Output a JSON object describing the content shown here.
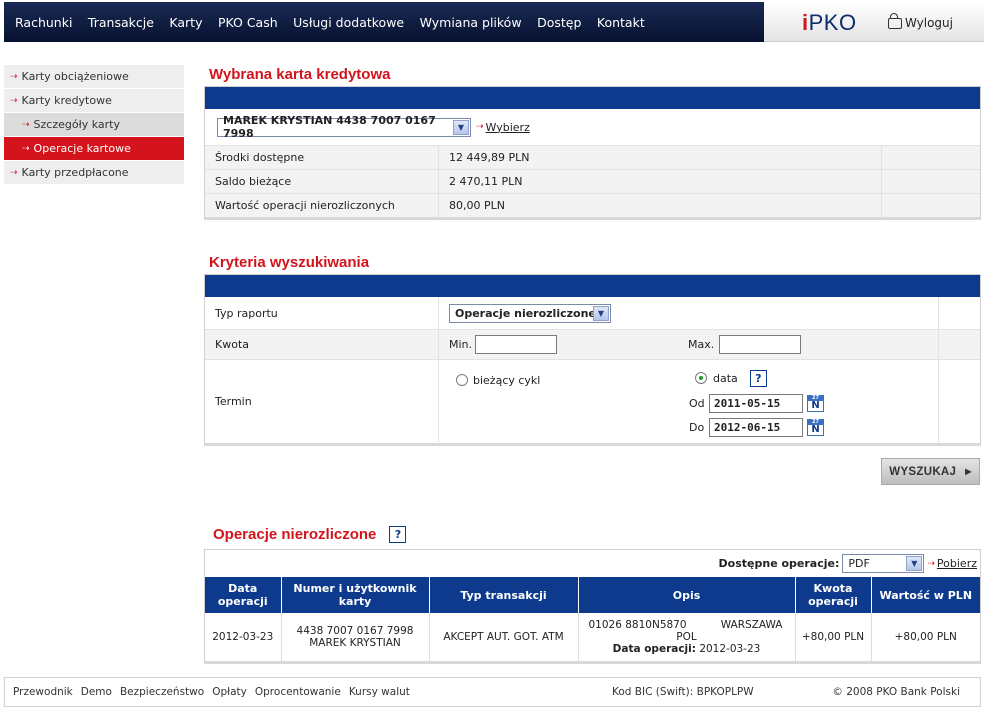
{
  "nav": {
    "items": [
      "Rachunki",
      "Transakcje",
      "Karty",
      "PKO Cash",
      "Usługi dodatkowe",
      "Wymiana plików",
      "Dostęp",
      "Kontakt"
    ],
    "logo_i": "i",
    "logo_rest": "PKO",
    "logout": "Wyloguj"
  },
  "sidebar": {
    "items": [
      {
        "label": "Karty obciążeniowe",
        "level": 0,
        "active": false
      },
      {
        "label": "Karty kredytowe",
        "level": 0,
        "active": false
      },
      {
        "label": "Szczegóły karty",
        "level": 1,
        "active": false
      },
      {
        "label": "Operacje kartowe",
        "level": 1,
        "active": true
      },
      {
        "label": "Karty przedpłacone",
        "level": 0,
        "active": false
      }
    ]
  },
  "card_section": {
    "title": "Wybrana karta kredytowa",
    "selected_card": "MAREK KRYSTIAN 4438 7007 0167 7998",
    "choose_link": "Wybierz",
    "rows": [
      {
        "label": "Środki dostępne",
        "value": "12 449,89 PLN"
      },
      {
        "label": "Saldo bieżące",
        "value": "2 470,11 PLN"
      },
      {
        "label": "Wartość operacji nierozliczonych",
        "value": "80,00 PLN"
      }
    ]
  },
  "search_section": {
    "title": "Kryteria wyszukiwania",
    "report_type_label": "Typ raportu",
    "report_type_value": "Operacje nierozliczone",
    "amount_label": "Kwota",
    "min_label": "Min.",
    "min_value": "",
    "max_label": "Max.",
    "max_value": "",
    "term_label": "Termin",
    "cycle_option": "bieżący cykl",
    "date_option": "data",
    "help": "?",
    "from_label": "Od",
    "from_value": "2011-05-15",
    "to_label": "Do",
    "to_value": "2012-06-15",
    "cal_top": "27",
    "cal_letter": "N",
    "search_button": "WYSZUKAJ"
  },
  "ops_section": {
    "title": "Operacje nierozliczone",
    "help": "?",
    "available_label": "Dostępne operacje:",
    "format_value": "PDF",
    "download_link": "Pobierz",
    "columns": [
      "Data operacji",
      "Numer i użytkownik karty",
      "Typ transakcji",
      "Opis",
      "Kwota operacji",
      "Wartość w PLN"
    ],
    "rows": [
      {
        "date": "2012-03-23",
        "card_number": "4438 7007 0167 7998",
        "card_user": "MAREK KRYSTIAN",
        "type": "AKCEPT AUT. GOT. ATM",
        "desc_code": "01026 8810N5870",
        "desc_city": "WARSZAWA",
        "desc_country": "POL",
        "desc_date_label": "Data operacji:",
        "desc_date": "2012-03-23",
        "amount": "+80,00 PLN",
        "value_pln": "+80,00 PLN"
      }
    ]
  },
  "footer": {
    "links": [
      "Przewodnik",
      "Demo",
      "Bezpieczeństwo",
      "Opłaty",
      "Oprocentowanie",
      "Kursy walut"
    ],
    "bic": "Kod BIC (Swift): BPKOPLPW",
    "copyright": "© 2008 PKO Bank Polski"
  }
}
